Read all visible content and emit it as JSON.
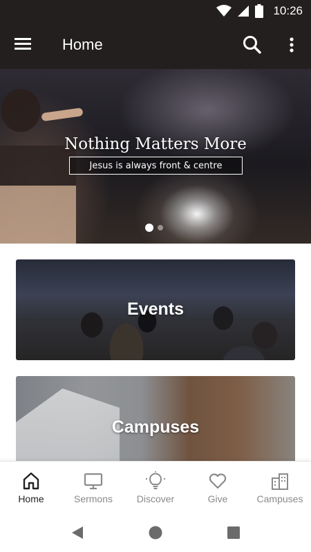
{
  "status_bar": {
    "time": "10:26",
    "icons": [
      "wifi-icon",
      "signal-icon",
      "battery-icon"
    ]
  },
  "app_bar": {
    "title": "Home",
    "icons": [
      "menu-icon",
      "search-icon",
      "more-vert-icon"
    ]
  },
  "hero": {
    "headline": "Nothing Matters More",
    "subline": "Jesus is always front & centre",
    "slide_count": 2,
    "active_slide": 1
  },
  "cards": {
    "events": {
      "title": "Events"
    },
    "campuses": {
      "title": "Campuses"
    }
  },
  "bottom_nav": {
    "items": [
      {
        "label": "Home",
        "icon": "home-icon",
        "active": true
      },
      {
        "label": "Sermons",
        "icon": "monitor-icon",
        "active": false
      },
      {
        "label": "Discover",
        "icon": "lightbulb-icon",
        "active": false
      },
      {
        "label": "Give",
        "icon": "heart-icon",
        "active": false
      },
      {
        "label": "Campuses",
        "icon": "buildings-icon",
        "active": false
      }
    ]
  },
  "system_nav": {
    "icons": [
      "back-icon",
      "home-circle-icon",
      "recents-icon"
    ]
  },
  "colors": {
    "app_bar_bg": "#231f1e",
    "active_nav": "#222222",
    "inactive_nav": "#8a8a8a"
  }
}
